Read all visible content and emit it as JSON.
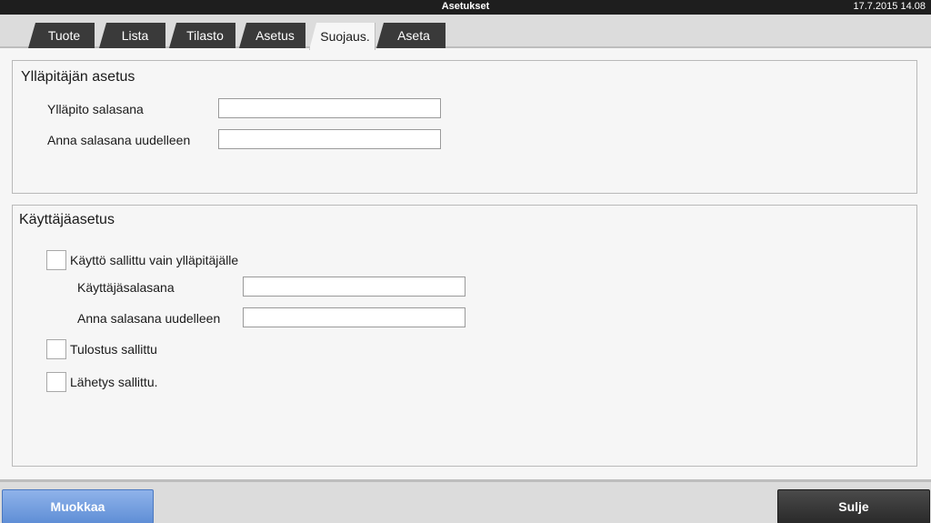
{
  "window": {
    "title": "Asetukset",
    "clock": "17.7.2015 14.08"
  },
  "tabs": [
    {
      "label": "Tuote"
    },
    {
      "label": "Lista"
    },
    {
      "label": "Tilasto"
    },
    {
      "label": "Asetus"
    },
    {
      "label": "Suojaus.",
      "active": true
    },
    {
      "label": "Aseta"
    }
  ],
  "admin_panel": {
    "title": "Ylläpitäjän asetus",
    "password_label": "Ylläpito salasana",
    "password_value": "",
    "confirm_label": "Anna salasana uudelleen",
    "confirm_value": ""
  },
  "user_panel": {
    "title": "Käyttäjäasetus",
    "admin_only": {
      "label": "Käyttö sallittu vain ylläpitäjälle",
      "checked": false
    },
    "user_password_label": "Käyttäjäsalasana",
    "user_password_value": "",
    "user_confirm_label": "Anna salasana uudelleen",
    "user_confirm_value": "",
    "print_allowed": {
      "label": "Tulostus sallittu",
      "checked": false
    },
    "send_allowed": {
      "label": "Lähetys sallittu.",
      "checked": false
    }
  },
  "footer": {
    "edit_label": "Muokkaa",
    "close_label": "Sulje"
  }
}
